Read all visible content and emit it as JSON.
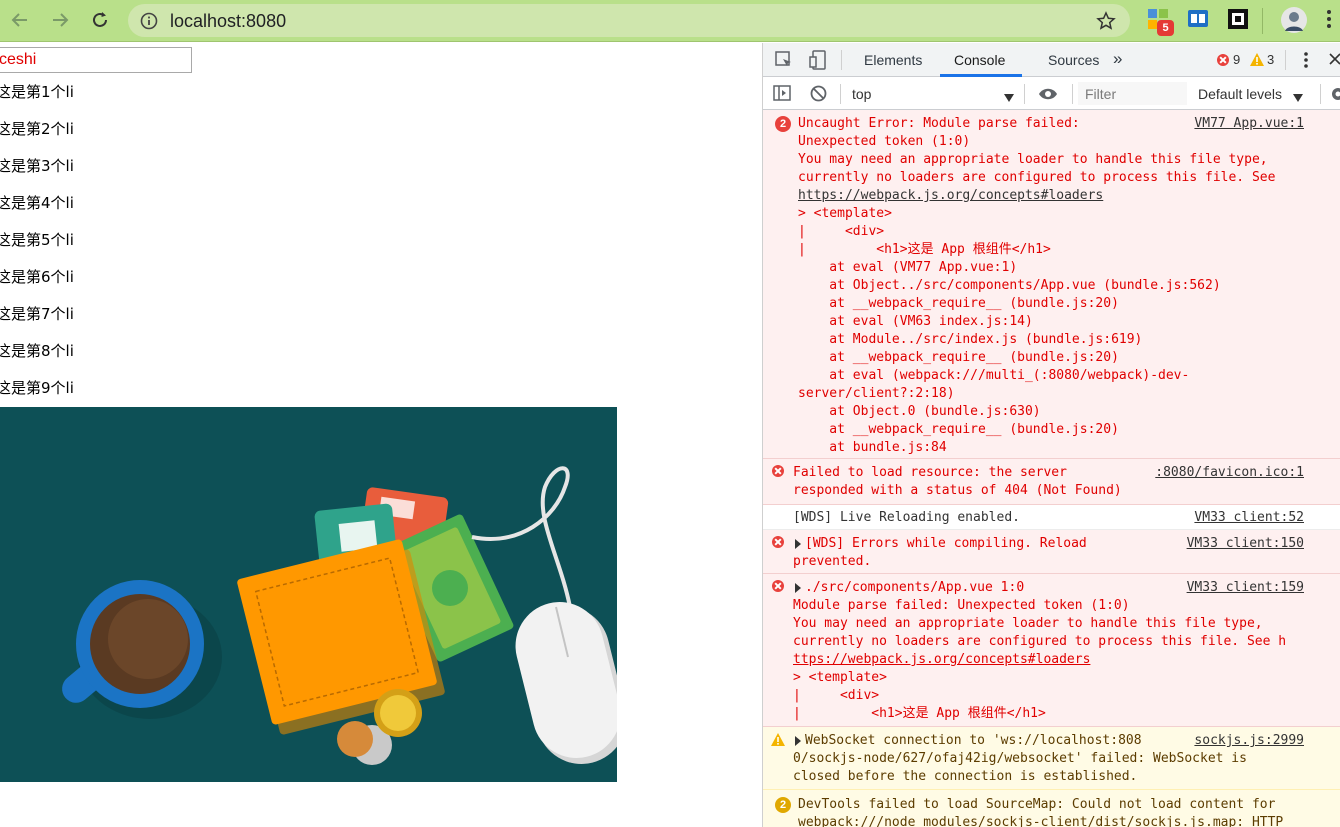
{
  "browser": {
    "url": "localhost:8080",
    "extension_badge": "5"
  },
  "page": {
    "input_value": "ceshi",
    "list_items": [
      "这是第1个li",
      "这是第2个li",
      "这是第3个li",
      "这是第4个li",
      "这是第5个li",
      "这是第6个li",
      "这是第7个li",
      "这是第8个li",
      "这是第9个li"
    ]
  },
  "devtools": {
    "tabs": {
      "elements": "Elements",
      "console": "Console",
      "sources": "Sources",
      "more": "»"
    },
    "error_count": "9",
    "warning_count": "3",
    "context": "top",
    "filter_placeholder": "Filter",
    "levels": "Default levels",
    "messages": {
      "m1": {
        "count": "2",
        "lines": [
          "Uncaught Error: Module parse failed:",
          "Unexpected token (1:0)",
          "You may need an appropriate loader to handle this file type,",
          "currently no loaders are configured to process this file. See",
          "https://webpack.js.org/concepts#loaders",
          "> <template>",
          "|     <div>",
          "|         <h1>这是 App 根组件</h1>",
          "    at eval (VM77 App.vue:1)",
          "    at Object../src/components/App.vue (bundle.js:562)",
          "    at __webpack_require__ (bundle.js:20)",
          "    at eval (VM63 index.js:14)",
          "    at Module../src/index.js (bundle.js:619)",
          "    at __webpack_require__ (bundle.js:20)",
          "    at eval (webpack:///multi_(:8080/webpack)-dev-",
          "server/client?:2:18)",
          "    at Object.0 (bundle.js:630)",
          "    at __webpack_require__ (bundle.js:20)",
          "    at bundle.js:84"
        ],
        "source": "VM77 App.vue:1"
      },
      "m2": {
        "lines": [
          "Failed to load resource: the server",
          "responded with a status of 404 (Not Found)"
        ],
        "source": ":8080/favicon.ico:1"
      },
      "m3": {
        "lines": [
          "[WDS] Live Reloading enabled."
        ],
        "source": "VM33 client:52"
      },
      "m4": {
        "lines": [
          "[WDS] Errors while compiling. Reload",
          "prevented."
        ],
        "source": "VM33 client:150"
      },
      "m5": {
        "lines": [
          "./src/components/App.vue 1:0",
          "Module parse failed: Unexpected token (1:0)",
          "You may need an appropriate loader to handle this file type,",
          "currently no loaders are configured to process this file. See h",
          "ttps://webpack.js.org/concepts#loaders",
          "> <template>",
          "|     <div>",
          "|         <h1>这是 App 根组件</h1>"
        ],
        "source": "VM33 client:159"
      },
      "m6": {
        "lines": [
          "WebSocket connection to 'ws://localhost:808",
          "0/sockjs-node/627/ofaj42ig/websocket' failed: WebSocket is",
          "closed before the connection is established."
        ],
        "source": "sockjs.js:2999"
      },
      "m7": {
        "count": "2",
        "lines": [
          "DevTools failed to load SourceMap: Could not load content for",
          "webpack:///node_modules/sockjs-client/dist/sockjs.js.map: HTTP"
        ]
      }
    }
  },
  "colors": {
    "browser_frame": "#b9e08a",
    "error_bg": "#fef0f0",
    "error_text": "#e00000",
    "warn_bg": "#fffbe5",
    "hero_bg": "#0d5056",
    "wallet": "#ff9800",
    "cup": "#1b74c5"
  },
  "icons": [
    "back-arrow-icon",
    "forward-arrow-icon",
    "reload-icon",
    "info-icon",
    "star-icon",
    "extension-icon",
    "reader-icon",
    "qr-icon",
    "profile-avatar",
    "inspect-icon",
    "device-toggle-icon",
    "sidebar-icon",
    "clear-console-icon",
    "eye-icon",
    "kebab-menu-icon",
    "gear-icon"
  ]
}
